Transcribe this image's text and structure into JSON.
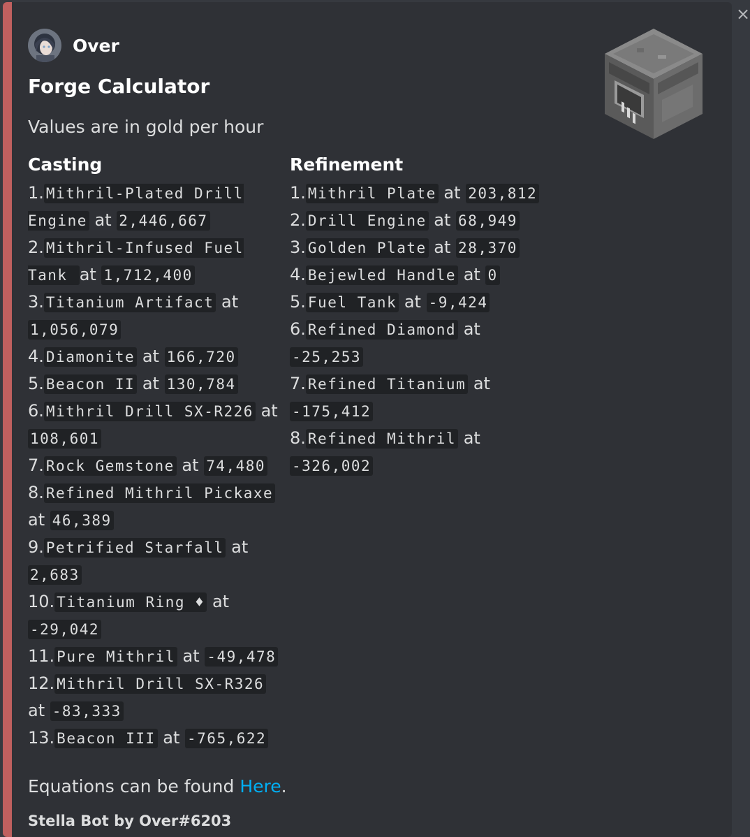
{
  "author": {
    "name": "Over"
  },
  "title": "Forge Calculator",
  "description": "Values are in gold per hour",
  "casting": {
    "name": "Casting",
    "items": [
      {
        "num": "1.",
        "name": "Mithril-Plated Drill Engine",
        "at": "at",
        "value": "2,446,667"
      },
      {
        "num": "2.",
        "name": "Mithril-Infused Fuel Tank ",
        "at": "at",
        "value": "1,712,400"
      },
      {
        "num": "3.",
        "name": "Titanium Artifact",
        "at": "at",
        "value": "1,056,079"
      },
      {
        "num": "4.",
        "name": "Diamonite",
        "at": "at",
        "value": "166,720"
      },
      {
        "num": "5.",
        "name": "Beacon II",
        "at": "at",
        "value": "130,784"
      },
      {
        "num": "6.",
        "name": "Mithril Drill SX-R226",
        "at": "at",
        "value": "108,601"
      },
      {
        "num": "7.",
        "name": "Rock Gemstone",
        "at": "at",
        "value": "74,480"
      },
      {
        "num": "8.",
        "name": "Refined Mithril Pickaxe",
        "at": "at",
        "value": "46,389"
      },
      {
        "num": "9.",
        "name": "Petrified Starfall",
        "at": "at",
        "value": "2,683"
      },
      {
        "num": "10.",
        "name": "Titanium Ring ♦",
        "at": "at",
        "value": "-29,042"
      },
      {
        "num": "11.",
        "name": "Pure Mithril",
        "at": "at",
        "value": "-49,478"
      },
      {
        "num": "12.",
        "name": "Mithril Drill SX-R326",
        "at": "at",
        "value": "-83,333"
      },
      {
        "num": "13.",
        "name": "Beacon III",
        "at": "at",
        "value": "-765,622"
      }
    ]
  },
  "refinement": {
    "name": "Refinement",
    "items": [
      {
        "num": "1.",
        "name": "Mithril Plate",
        "at": "at",
        "value": "203,812"
      },
      {
        "num": "2.",
        "name": "Drill Engine",
        "at": "at",
        "value": "68,949"
      },
      {
        "num": "3.",
        "name": "Golden Plate",
        "at": "at",
        "value": "28,370"
      },
      {
        "num": "4.",
        "name": "Bejewled Handle",
        "at": "at",
        "value": "0"
      },
      {
        "num": "5.",
        "name": "Fuel Tank",
        "at": "at",
        "value": "-9,424"
      },
      {
        "num": "6.",
        "name": "Refined Diamond",
        "at": "at",
        "value": "-25,253"
      },
      {
        "num": "7.",
        "name": "Refined Titanium",
        "at": "at",
        "value": "-175,412"
      },
      {
        "num": "8.",
        "name": "Refined Mithril",
        "at": "at",
        "value": "-326,002"
      }
    ]
  },
  "equations": {
    "prefix": "Equations can be found ",
    "link": "Here",
    "suffix": "."
  },
  "footer": "Stella Bot by Over#6203",
  "close_icon": "×",
  "colors": {
    "accent": "#c0605f",
    "link": "#00aff4",
    "embed_bg": "#2f3136",
    "code_bg": "#202225"
  }
}
